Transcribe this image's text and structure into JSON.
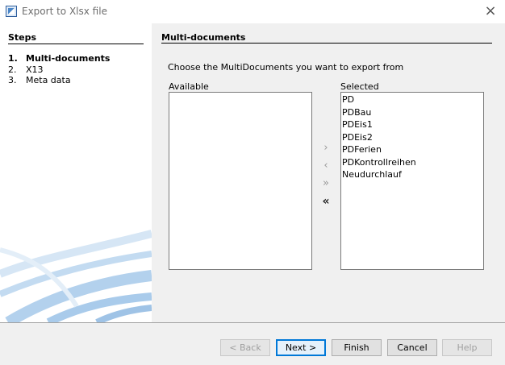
{
  "window": {
    "title": "Export to Xlsx file",
    "close_icon": "×"
  },
  "steps": {
    "title": "Steps",
    "items": [
      {
        "num": "1.",
        "label": "Multi-documents",
        "active": true
      },
      {
        "num": "2.",
        "label": "X13",
        "active": false
      },
      {
        "num": "3.",
        "label": "Meta data",
        "active": false
      }
    ]
  },
  "content": {
    "section_title": "Multi-documents",
    "instruction": "Choose the MultiDocuments you want to export from",
    "available_label": "Available",
    "selected_label": "Selected",
    "available_items": [],
    "selected_items": [
      "PD",
      "PDBau",
      "PDEis1",
      "PDEis2",
      "PDFerien",
      "PDKontrollreihen",
      "Neudurchlauf"
    ],
    "move_buttons": {
      "move_right": "›",
      "move_left": "‹",
      "move_all_right": "»",
      "move_all_left": "«"
    }
  },
  "footer": {
    "back_label": "< Back",
    "next_label": "Next >",
    "finish_label": "Finish",
    "cancel_label": "Cancel",
    "help_label": "Help"
  },
  "colors": {
    "panel_bg": "#f0f0f0",
    "accent": "#0078d7",
    "decoration": "#9fc3e6"
  }
}
